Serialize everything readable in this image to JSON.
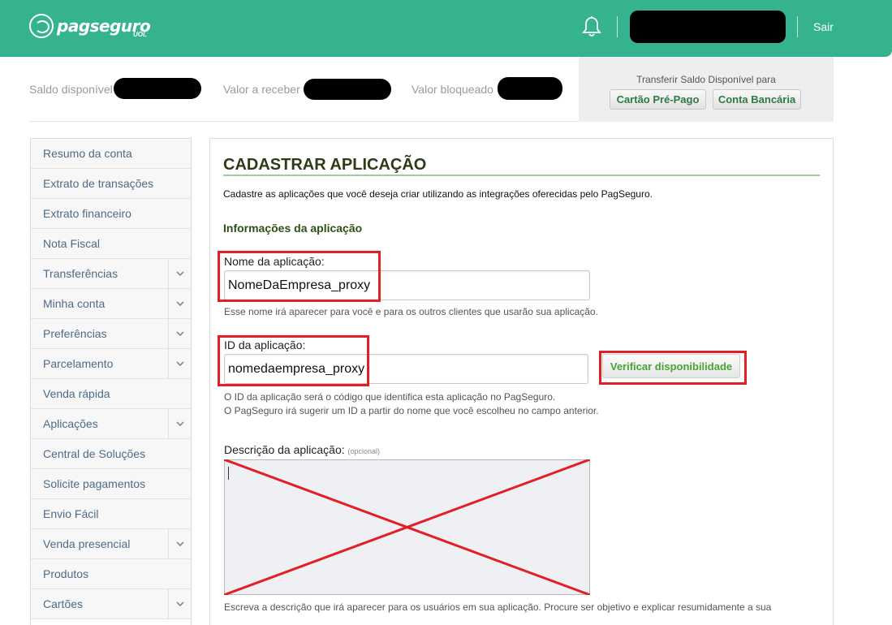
{
  "header": {
    "brand": "pagseguro",
    "brand_sub": "UOL",
    "logout": "Sair"
  },
  "balances": {
    "available": "Saldo disponível",
    "to_receive": "Valor a receber",
    "blocked": "Valor bloqueado"
  },
  "transfer": {
    "title": "Transferir Saldo Disponível para",
    "prepaid_card": "Cartão Pré-Pago",
    "bank_account": "Conta Bancária"
  },
  "sidebar": {
    "items": [
      {
        "label": "Resumo da conta",
        "expandable": false
      },
      {
        "label": "Extrato de transações",
        "expandable": false
      },
      {
        "label": "Extrato financeiro",
        "expandable": false
      },
      {
        "label": "Nota Fiscal",
        "expandable": false
      },
      {
        "label": "Transferências",
        "expandable": true
      },
      {
        "label": "Minha conta",
        "expandable": true
      },
      {
        "label": "Preferências",
        "expandable": true
      },
      {
        "label": "Parcelamento",
        "expandable": true
      },
      {
        "label": "Venda rápida",
        "expandable": false
      },
      {
        "label": "Aplicações",
        "expandable": true
      },
      {
        "label": "Central de Soluções",
        "expandable": false
      },
      {
        "label": "Solicite pagamentos",
        "expandable": false
      },
      {
        "label": "Envio Fácil",
        "expandable": false
      },
      {
        "label": "Venda presencial",
        "expandable": true
      },
      {
        "label": "Produtos",
        "expandable": false
      },
      {
        "label": "Cartões",
        "expandable": true
      }
    ]
  },
  "main": {
    "title": "CADASTRAR APLICAÇÃO",
    "intro": "Cadastre as aplicações que você deseja criar utilizando as integrações oferecidas pelo PagSeguro.",
    "section": "Informações da aplicação",
    "app_name": {
      "label": "Nome da aplicação:",
      "value": "NomeDaEmpresa_proxy",
      "hint": "Esse nome irá aparecer para você e para os outros clientes que usarão sua aplicação."
    },
    "app_id": {
      "label": "ID da aplicação:",
      "value": "nomedaempresa_proxy",
      "verify": "Verificar disponibilidade",
      "hint1": "O ID da aplicação será o código que identifica esta aplicação no PagSeguro.",
      "hint2": "O PagSeguro irá sugerir um ID a partir do nome que você escolheu no campo anterior."
    },
    "description": {
      "label": "Descrição da aplicação:",
      "optional": "(opcional)",
      "value": "",
      "hint": "Escreva a descrição que irá aparecer para os usuários em sua aplicação. Procure ser objetivo e explicar resumidamente a sua"
    }
  },
  "colors": {
    "header_green": "#35b38f",
    "annotation_red": "#e21f26",
    "title_dark_green": "#2e3b16",
    "button_green": "#4aa535"
  }
}
